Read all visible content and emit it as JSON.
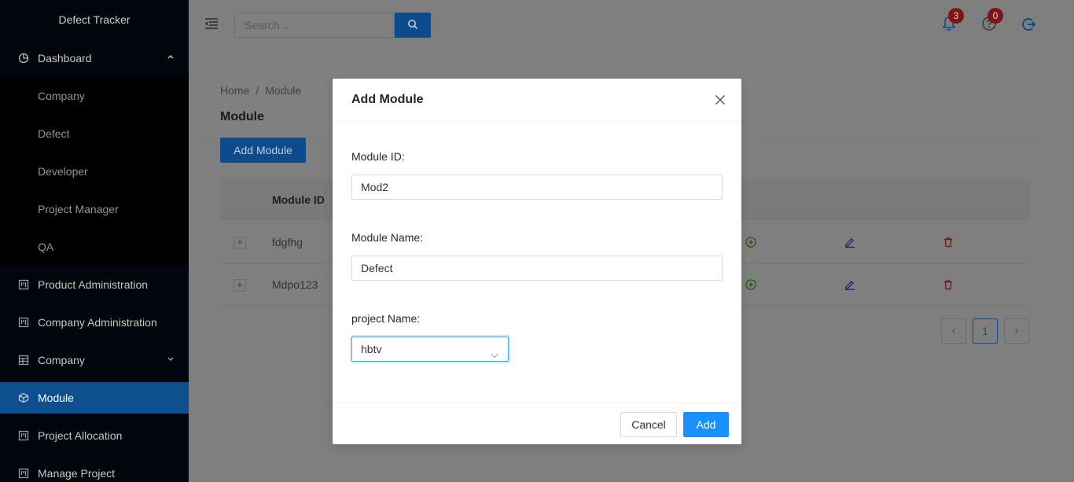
{
  "app": {
    "title": "Defect Tracker"
  },
  "sidebar": {
    "items": [
      {
        "label": "Dashboard",
        "icon": "pie-chart-icon",
        "expanded": true,
        "children": [
          "Company",
          "Defect",
          "Developer",
          "Project Manager",
          "QA"
        ]
      },
      {
        "label": "Product Administration",
        "icon": "project-icon"
      },
      {
        "label": "Company Administration",
        "icon": "project-icon"
      },
      {
        "label": "Company",
        "icon": "table-icon",
        "collapsed": true
      },
      {
        "label": "Module",
        "icon": "cube-icon",
        "active": true
      },
      {
        "label": "Project Allocation",
        "icon": "project-icon"
      },
      {
        "label": "Manage Project",
        "icon": "project-icon"
      }
    ]
  },
  "header": {
    "search_placeholder": "Search ..",
    "notifications_count": "3",
    "help_count": "0"
  },
  "page": {
    "breadcrumb": [
      "Home",
      "Module"
    ],
    "title": "Module",
    "add_button": "Add Module",
    "table": {
      "columns": [
        "Module ID"
      ],
      "rows": [
        {
          "module_id": "fdgfhg"
        },
        {
          "module_id": "Mdpo123"
        }
      ]
    },
    "pagination": {
      "current": "1"
    }
  },
  "modal": {
    "title": "Add Module",
    "fields": {
      "module_id_label": "Module ID:",
      "module_id_value": "Mod2",
      "module_name_label": "Module Name:",
      "module_name_value": "Defect",
      "project_name_label": "project Name:",
      "project_name_value": "hbtv"
    },
    "cancel_label": "Cancel",
    "submit_label": "Add"
  },
  "colors": {
    "sidebar_bg": "#001529",
    "active_item": "#1890ff",
    "primary": "#1890ff",
    "badge": "#ff4d4f",
    "add_icon": "#52c41a",
    "edit_icon": "#2f54eb",
    "delete_icon": "#f5222d"
  }
}
